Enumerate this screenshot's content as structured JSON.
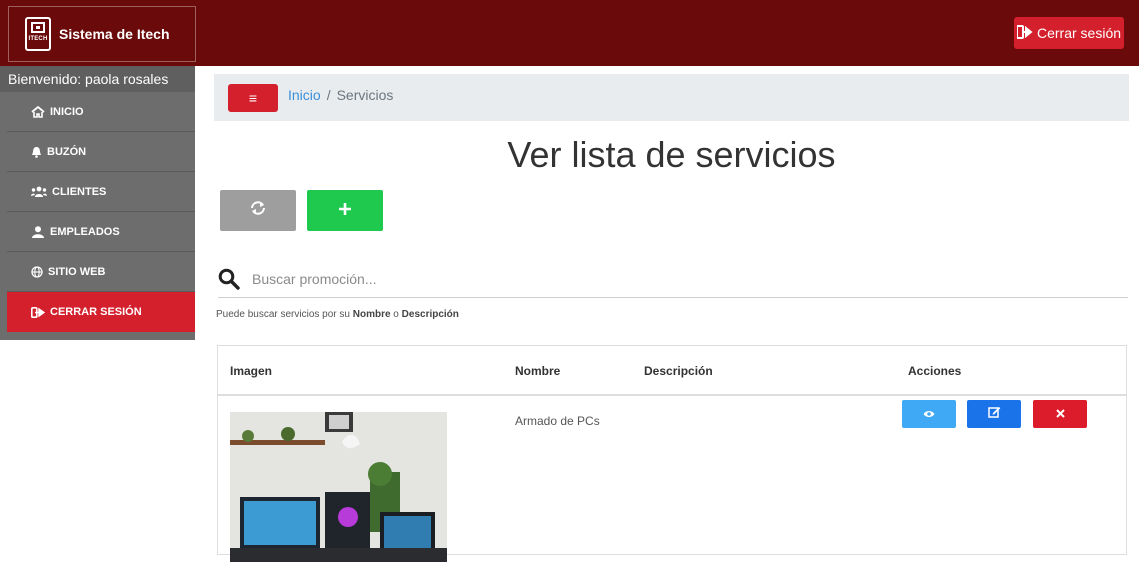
{
  "app": {
    "brand_title": "Sistema de Itech",
    "logo_text": "ITECH",
    "logout_top_label": "Cerrar sesión"
  },
  "sidebar": {
    "welcome": "Bienvenido: paola rosales",
    "items": [
      {
        "label": "INICIO",
        "icon": "home-icon"
      },
      {
        "label": "BUZÓN",
        "icon": "bell-icon"
      },
      {
        "label": "CLIENTES",
        "icon": "users-icon"
      },
      {
        "label": "EMPLEADOS",
        "icon": "user-icon"
      },
      {
        "label": "SITIO WEB",
        "icon": "globe-icon"
      },
      {
        "label": "CERRAR SESIÓN",
        "icon": "sign-out-icon",
        "active": true
      }
    ]
  },
  "breadcrumb": {
    "menu_symbol": "≡",
    "home": "Inicio",
    "separator": "/",
    "current": "Servicios"
  },
  "page": {
    "title": "Ver lista de servicios"
  },
  "search": {
    "placeholder": "Buscar promoción...",
    "help_prefix": "Puede buscar servicios por su ",
    "help_field1": "Nombre",
    "help_mid": " o ",
    "help_field2": "Descripción"
  },
  "table": {
    "headers": [
      "Imagen",
      "Nombre",
      "Descripción",
      "Acciones"
    ],
    "rows": [
      {
        "nombre": "Armado de PCs",
        "descripcion": ""
      }
    ]
  },
  "colors": {
    "navbar": "#6b0a0a",
    "accent_red": "#d3202c",
    "add_green": "#1fc94e",
    "view_blue": "#3fa9f5",
    "edit_blue": "#1a73e8"
  }
}
